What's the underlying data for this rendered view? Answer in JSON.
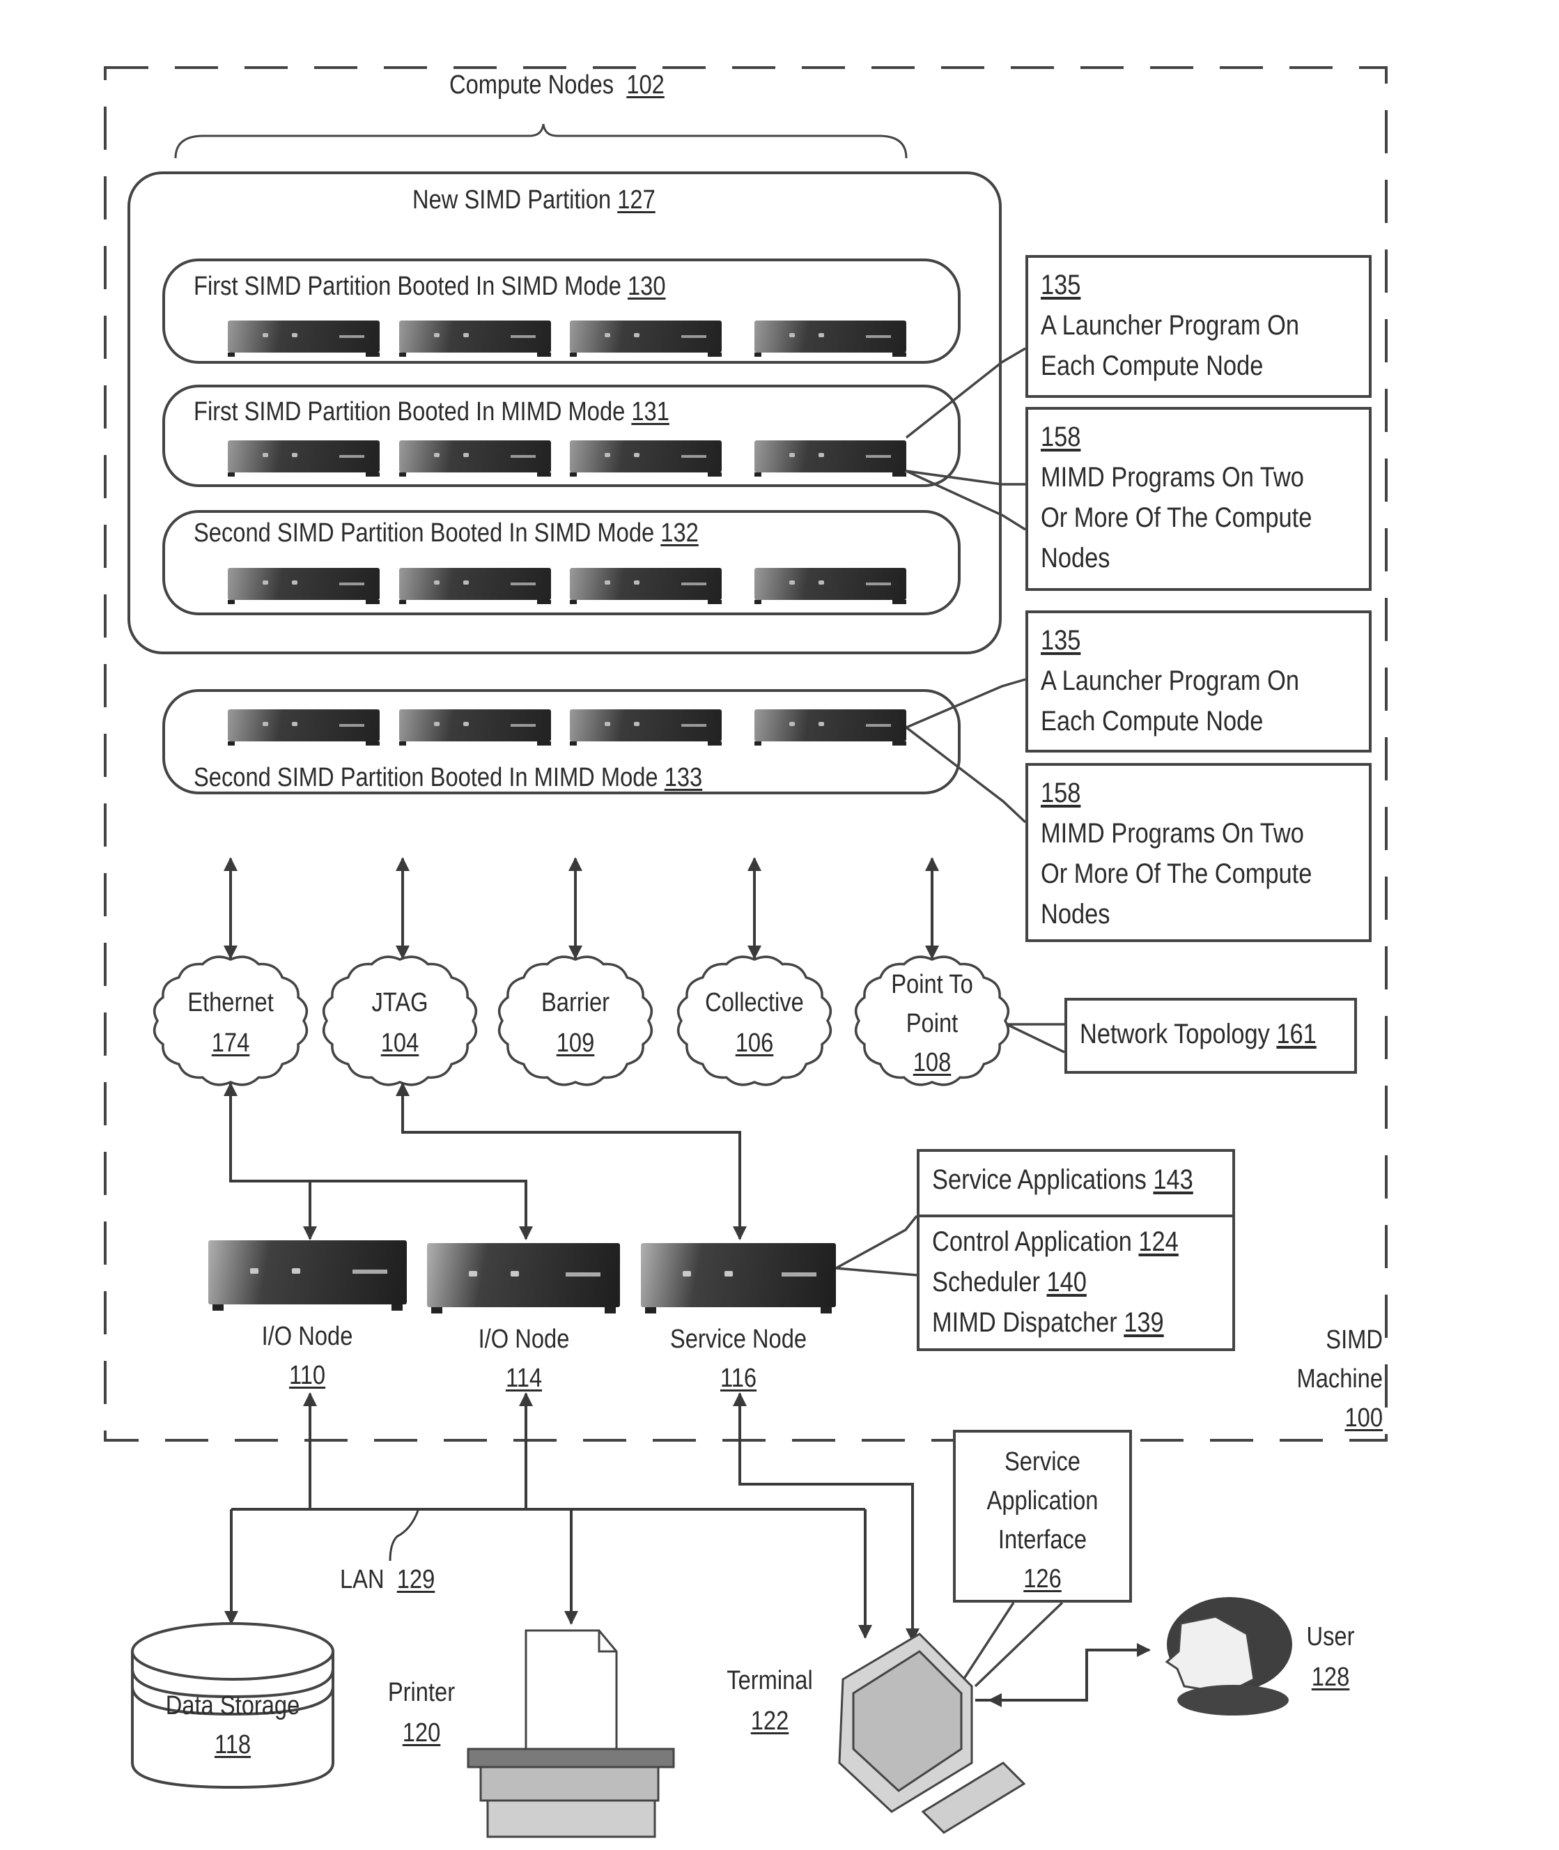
{
  "machine": {
    "name": "SIMD",
    "name_line2": "Machine",
    "ref": "100"
  },
  "compute_nodes": {
    "label": "Compute Nodes",
    "ref": "102"
  },
  "new_partition": {
    "label": "New SIMD Partition",
    "ref": "127"
  },
  "partitions": [
    {
      "label": "First SIMD Partition Booted In SIMD Mode",
      "ref": "130",
      "node_count": 4
    },
    {
      "label": "First SIMD Partition Booted In MIMD Mode",
      "ref": "131",
      "node_count": 4
    },
    {
      "label": "Second SIMD Partition Booted In SIMD Mode",
      "ref": "132",
      "node_count": 4
    },
    {
      "label": "Second SIMD Partition Booted In MIMD Mode",
      "ref": "133",
      "node_count": 4
    }
  ],
  "callouts": [
    {
      "ref": "135",
      "lines": [
        "A Launcher Program On",
        "Each Compute Node"
      ]
    },
    {
      "ref": "158",
      "lines": [
        "MIMD Programs On Two",
        "Or More Of The Compute",
        "Nodes"
      ]
    },
    {
      "ref": "135",
      "lines": [
        "A Launcher Program On",
        "Each Compute Node"
      ]
    },
    {
      "ref": "158",
      "lines": [
        "MIMD Programs On Two",
        "Or More Of The Compute",
        "Nodes"
      ]
    }
  ],
  "networks": [
    {
      "label": "Ethernet",
      "ref": "174"
    },
    {
      "label": "JTAG",
      "ref": "104"
    },
    {
      "label": "Barrier",
      "ref": "109"
    },
    {
      "label": "Collective",
      "ref": "106"
    },
    {
      "label": "Point To Point",
      "label_line1": "Point To",
      "label_line2": "Point",
      "ref": "108"
    }
  ],
  "network_topology": {
    "label": "Network Topology",
    "ref": "161"
  },
  "service_applications": {
    "header": "Service Applications",
    "ref": "143",
    "items": [
      {
        "label": "Control Application",
        "ref": "124"
      },
      {
        "label": "Scheduler",
        "ref": "140"
      },
      {
        "label": "MIMD Dispatcher",
        "ref": "139"
      }
    ]
  },
  "io_nodes": [
    {
      "label": "I/O Node",
      "ref": "110"
    },
    {
      "label": "I/O Node",
      "ref": "114"
    },
    {
      "label": "Service Node",
      "ref": "116"
    }
  ],
  "service_app_interface": {
    "lines": [
      "Service",
      "Application",
      "Interface"
    ],
    "ref": "126"
  },
  "lan": {
    "label": "LAN",
    "ref": "129"
  },
  "devices": {
    "data_storage": {
      "label": "Data Storage",
      "ref": "118"
    },
    "printer": {
      "label": "Printer",
      "ref": "120"
    },
    "terminal": {
      "label": "Terminal",
      "ref": "122"
    },
    "user": {
      "label": "User",
      "ref": "128"
    }
  }
}
